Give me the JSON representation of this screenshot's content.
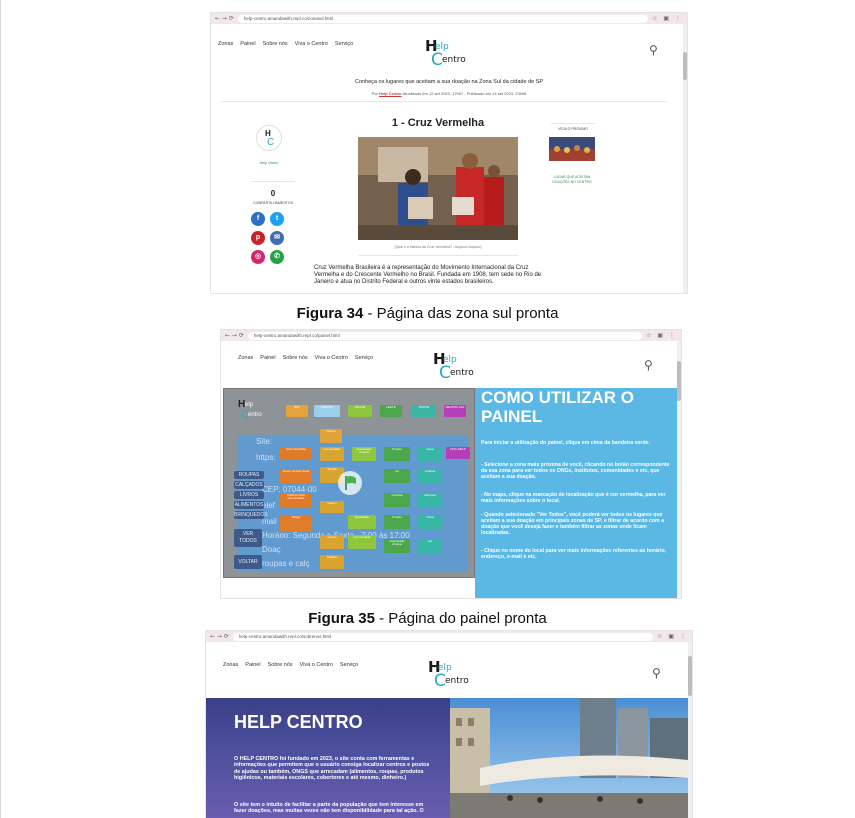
{
  "captions": {
    "fig34_num": "Figura 34",
    "fig34_text": " - Página das zona sul  pronta",
    "fig35_num": "Figura 35",
    "fig35_text": " - Página do painel pronta"
  },
  "site_nav": [
    "Zonas",
    "Painel",
    "Sobre nós",
    "Viva o Centro",
    "Serviço"
  ],
  "logo": {
    "h": "H",
    "elp": "elp",
    "c": "C",
    "entro": "entro"
  },
  "fig34": {
    "url": "help-centro.amandawith.repl.co/zonasul.html",
    "intro": "Conheça os lugares que aceitam a sua doação na Zona Sul da cidade de SP",
    "meta_prefix": "Por ",
    "meta_author": "Help Centro",
    "meta_suffix": " Atualizado em 12 set 2023, 17h57 - Publicado em 14 set 2023, 23h08",
    "author_label": "Help Centro",
    "comment_count": "0",
    "comment_label": "COMPARTILHAMENTOS",
    "article_title": "1 - Cruz Vermelha",
    "photo_caption": "(Qual é a história da Cruz Vermelha? - Arquivo/ Arquivo)",
    "body": "Cruz Vermelha Brasileira é a representação do Movimento Internacional da Cruz Vermelha e do Crescente Vermelho no Brasil. Fundada em 1908, tem sede no Rio de Janeiro e atua no Distrito Federal e outros vinte estados brasileiros.",
    "side_top": "VEJA O PRÓXIMO",
    "side_bottom": "LUGAR QUE ACEITAM DOAÇÕES NO CENTRO",
    "social": [
      "f",
      "t",
      "p",
      "✉",
      "◎",
      "✆"
    ]
  },
  "fig35": {
    "url": "help-centro.amandawith.repl.co/painel.html",
    "panel_title": "COMO UTILIZAR O PAINEL",
    "instructions": [
      "Para iniciar a utilização do painel, clique em cima da bandeira verde.",
      "- Selecione a zona mais próxima de você, clicando no botão correspondente da sua zona para ver todos os ONGs, institutos, comunidades e etc, que aceitam a sua doação.",
      "- No maps, clique na marcação de localização que é cor vermelha, para ver mais informações sobre o local.",
      "- Quando selecionado \"Ver Todos\", você poderá ver todos os lugares que aceitam a sua doação em principais zonas de SP, e filtrar de acordo com a doação que você deseja fazer e também filtrar as zonas onde ficam localizadas.",
      "- Clique no nome do local para ver mais informações referentes ao horário, endereço, e-mail e etc."
    ],
    "zone_buttons": [
      "SUL",
      "CENTRO",
      "OESTE",
      "LESTE",
      "NORTE",
      "CENTRO SUL"
    ],
    "left_buttons": [
      "ROUPAS",
      "CALÇADOS",
      "LIVROS",
      "ALIMENTOS",
      "BRINQUEDOS",
      "VER TODOS",
      "VOLTAR"
    ],
    "ghost_lines": [
      "Site:",
      "https:",
      "CEP: 07044-00",
      "elef",
      "mail",
      "Horário: Segunda a Sexta - 7:00 às 17:00",
      "Doaç",
      "roupas e calç"
    ],
    "tiles": [
      "Cruz Vermelha",
      "Grupo Gestão Sopa",
      "Instituto Criar Comunidade",
      "Associação Amigos",
      "Casa 1",
      "Templo",
      "Lar",
      "Instituto",
      "Cozinha",
      "Albergue",
      "Abrigo",
      "Sociedade",
      "Projeto",
      "Casa",
      "ONG ABCP",
      "Comunidade",
      "Centro"
    ]
  },
  "fig36": {
    "url": "help-centro.amandawith.repl.co/sobrenos.html",
    "hero_title": "HELP CENTRO",
    "p1": "O HELP CENTRO foi fundado em 2023, o site conta com ferramentas e informações que permitem que o usuário consiga localizar centros e postos de ajudas ou também, ONGS que arrecadam (alimentos, roupas, produtos higiênicos, materiais escolares, cobertores e até mesmo, dinheiro.)",
    "p2": "O site tem o intuito de facilitar a parte da população que tem interesse em fazer doações, mas muitas vezes não tem disponibilidade para tal ação. O"
  },
  "colors": {
    "accent": "#2aa8c4",
    "panel_blue": "#5bb7e4",
    "hero_purple": "#4a4f9c"
  }
}
